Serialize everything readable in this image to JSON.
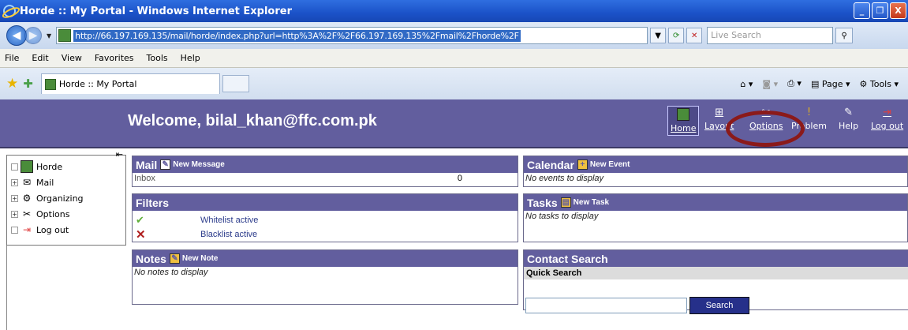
{
  "window": {
    "title": "Horde :: My Portal - Windows Internet Explorer",
    "controls": [
      "_",
      "❐",
      "X"
    ]
  },
  "address_bar": {
    "url": "http://66.197.169.135/mail/horde/index.php?url=http%3A%2F%2F66.197.169.135%2Fmail%2Fhorde%2F",
    "search_placeholder": "Live Search"
  },
  "menu": [
    "File",
    "Edit",
    "View",
    "Favorites",
    "Tools",
    "Help"
  ],
  "tab": {
    "label": "Horde :: My Portal"
  },
  "command_bar": {
    "page_label": "Page",
    "tools_label": "Tools"
  },
  "header": {
    "welcome": "Welcome, bilal_khan@ffc.com.pk",
    "nav": {
      "home": "Home",
      "layout": "Layout",
      "options": "Options",
      "problem": "Problem",
      "help": "Help",
      "logout": "Log out"
    }
  },
  "sidebar": {
    "items": [
      {
        "label": "Horde"
      },
      {
        "label": "Mail"
      },
      {
        "label": "Organizing"
      },
      {
        "label": "Options"
      },
      {
        "label": "Log out"
      }
    ]
  },
  "blocks": {
    "mail": {
      "title": "Mail",
      "action": "New Message",
      "inbox_label": "Inbox",
      "inbox_count": "0"
    },
    "calendar": {
      "title": "Calendar",
      "action": "New Event",
      "empty": "No events to display"
    },
    "filters": {
      "title": "Filters",
      "whitelist": "Whitelist active",
      "blacklist": "Blacklist active"
    },
    "tasks": {
      "title": "Tasks",
      "action": "New Task",
      "empty": "No tasks to display"
    },
    "notes": {
      "title": "Notes",
      "action": "New Note",
      "empty": "No notes to display"
    },
    "contact_search": {
      "title": "Contact Search",
      "subheader": "Quick Search",
      "button": "Search"
    }
  }
}
